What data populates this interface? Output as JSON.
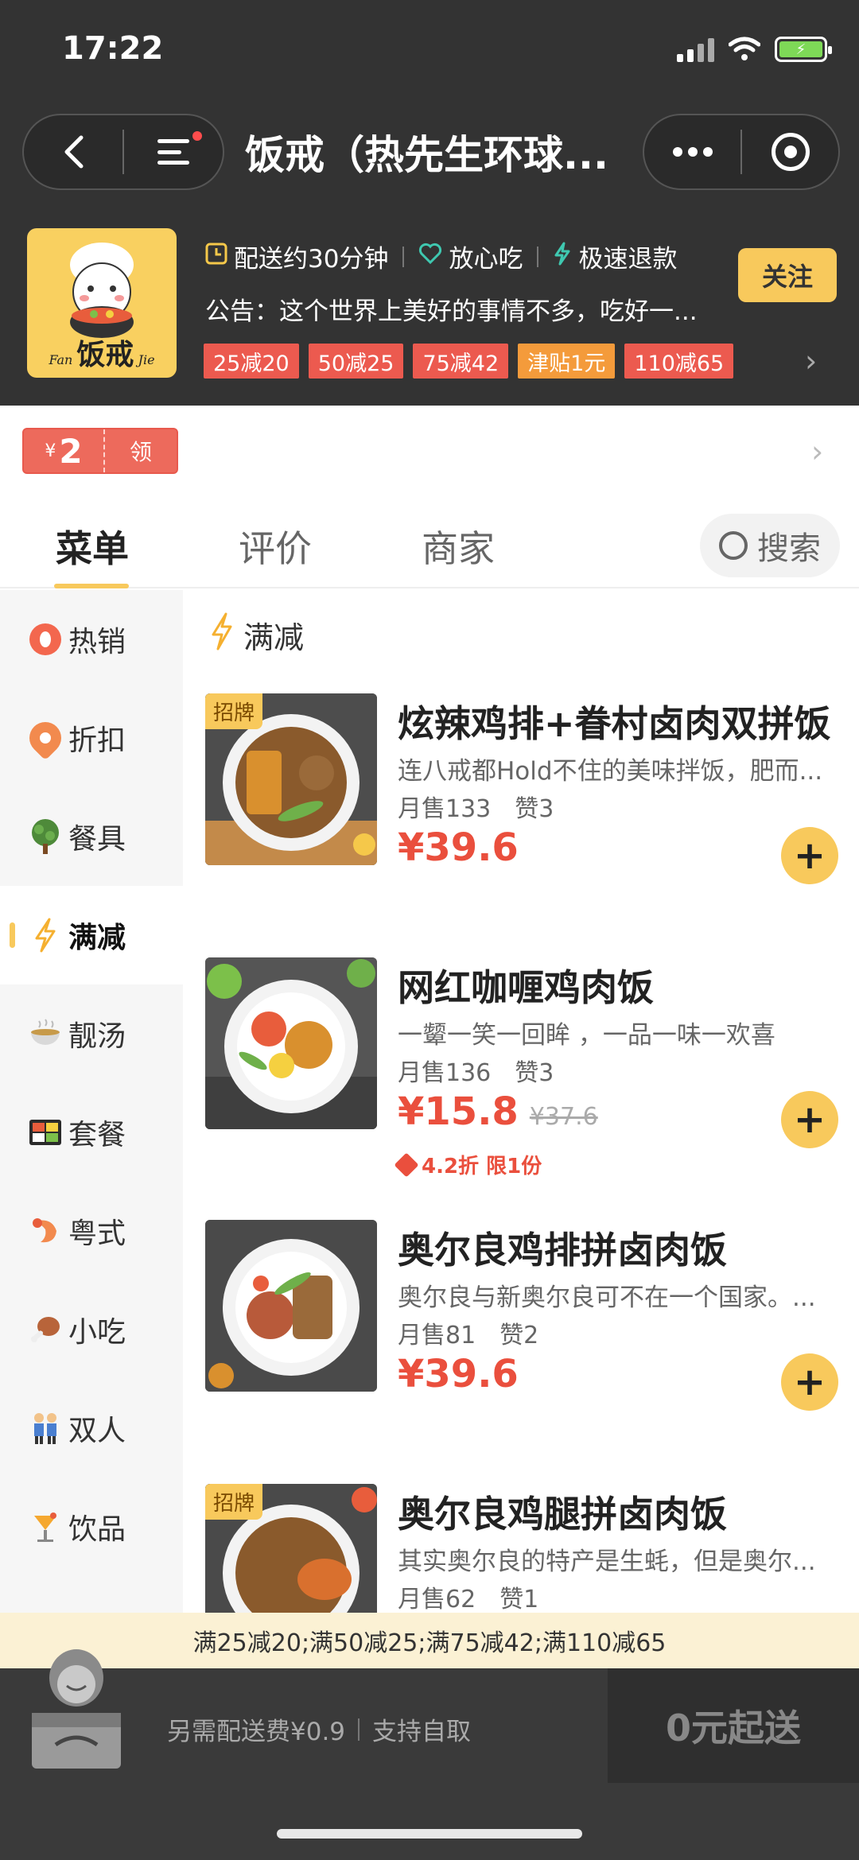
{
  "status": {
    "time": "17:22"
  },
  "header": {
    "title": "饭戒（热先生环球..."
  },
  "store": {
    "logo_text": "饭戒",
    "logo_left": "Fan",
    "logo_right": "Jie",
    "features": [
      "配送约30分钟",
      "放心吃",
      "极速退款"
    ],
    "follow_label": "关注",
    "notice": "公告：这个世界上美好的事情不多，吃好一...",
    "promos": [
      {
        "label": "25减20",
        "color": "#ec5a4f"
      },
      {
        "label": "50减25",
        "color": "#ec5a4f"
      },
      {
        "label": "75减42",
        "color": "#ec5a4f"
      },
      {
        "label": "津贴1元",
        "color": "#f49b3b"
      },
      {
        "label": "110减65",
        "color": "#ec5a4f"
      }
    ]
  },
  "coupon": {
    "currency": "¥",
    "amount": "2",
    "action": "领"
  },
  "tabs": {
    "menu": "菜单",
    "reviews": "评价",
    "merchant": "商家",
    "search": "搜索"
  },
  "sidebar": {
    "items": [
      {
        "label": "热销",
        "icon": "hot-icon"
      },
      {
        "label": "折扣",
        "icon": "discount-icon"
      },
      {
        "label": "餐具",
        "icon": "tree-icon"
      },
      {
        "label": "满减",
        "icon": "bolt-icon"
      },
      {
        "label": "靓汤",
        "icon": "soup-icon"
      },
      {
        "label": "套餐",
        "icon": "bento-icon"
      },
      {
        "label": "粤式",
        "icon": "shrimp-icon"
      },
      {
        "label": "小吃",
        "icon": "drumstick-icon"
      },
      {
        "label": "双人",
        "icon": "couple-icon"
      },
      {
        "label": "饮品",
        "icon": "drink-icon"
      }
    ]
  },
  "section": {
    "title": "满减"
  },
  "dishes": [
    {
      "badge": "招牌",
      "name": "炫辣鸡排+眷村卤肉双拼饭",
      "desc": "连八戒都Hold不住的美味拌饭，肥而...",
      "sold": "月售133",
      "likes": "赞3",
      "price": "¥39.6"
    },
    {
      "badge": "",
      "name": "网红咖喱鸡肉饭",
      "desc": "一颦一笑一回眸 ，一品一味一欢喜",
      "sold": "月售136",
      "likes": "赞3",
      "price": "¥15.8",
      "old_price": "¥37.6",
      "discount": "4.2折 限1份"
    },
    {
      "badge": "",
      "name": "奥尔良鸡排拼卤肉饭",
      "desc": "奥尔良与新奥尔良可不在一个国家。...",
      "sold": "月售81",
      "likes": "赞2",
      "price": "¥39.6"
    },
    {
      "badge": "招牌",
      "name": "奥尔良鸡腿拼卤肉饭",
      "desc": "其实奥尔良的特产是生蚝，但是奥尔...",
      "sold": "月售62",
      "likes": "赞1",
      "price": ""
    }
  ],
  "promo_strip": "满25减20;满50减25;满75减42;满110减65",
  "cart": {
    "delivery_fee": "另需配送费¥0.9",
    "pickup": "支持自取",
    "min_order": "0元起送"
  }
}
